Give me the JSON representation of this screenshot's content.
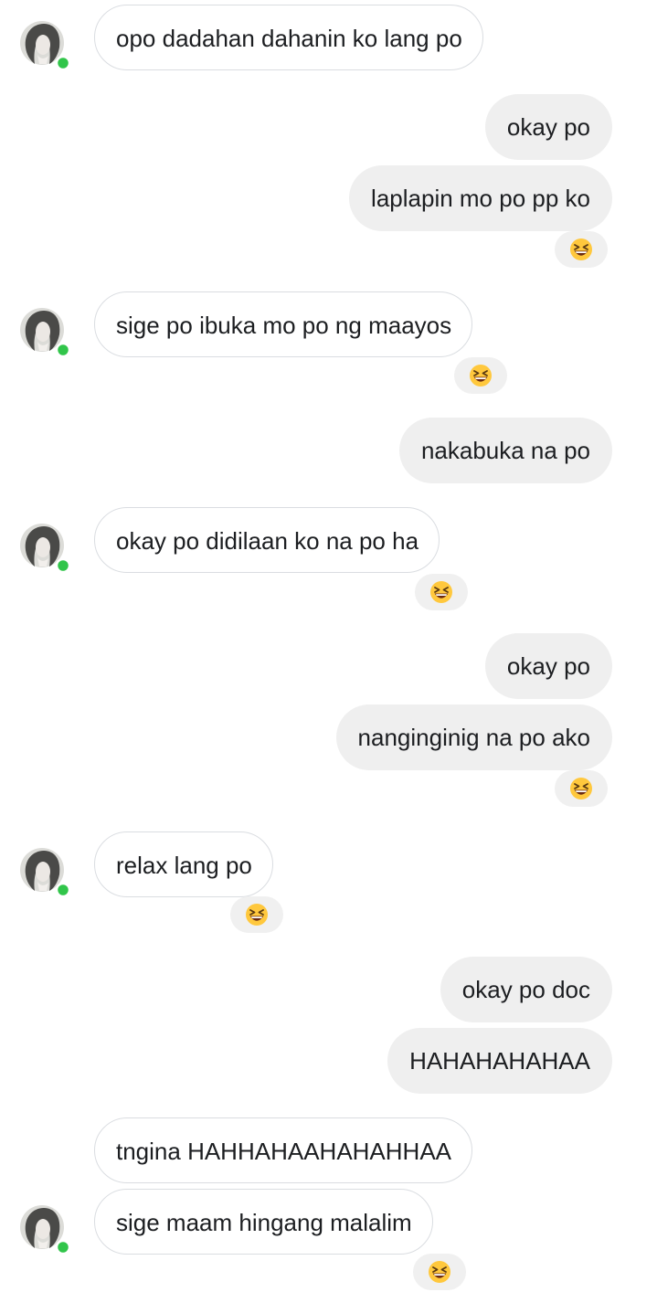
{
  "conversation": {
    "messages": [
      {
        "direction": "incoming",
        "text": "opo dadahan dahanin ko lang po",
        "avatar": true
      },
      {
        "direction": "outgoing",
        "text": "okay po"
      },
      {
        "direction": "outgoing",
        "text": "laplapin mo po pp ko",
        "reaction": "laughing-emoji"
      },
      {
        "direction": "incoming",
        "text": "sige po ibuka mo po ng maayos",
        "avatar": true,
        "reaction": "laughing-emoji"
      },
      {
        "direction": "outgoing",
        "text": "nakabuka na po"
      },
      {
        "direction": "incoming",
        "text": "okay po didilaan ko na po ha",
        "avatar": true,
        "reaction": "laughing-emoji"
      },
      {
        "direction": "outgoing",
        "text": "okay po"
      },
      {
        "direction": "outgoing",
        "text": "nanginginig na po ako",
        "reaction": "laughing-emoji"
      },
      {
        "direction": "incoming",
        "text": "relax lang po",
        "avatar": true,
        "reaction": "laughing-emoji"
      },
      {
        "direction": "outgoing",
        "text": "okay po doc"
      },
      {
        "direction": "outgoing",
        "text": "HAHAHAHAHAA"
      },
      {
        "direction": "incoming",
        "text": "tngina HAHHAHAAHAHAHHAA"
      },
      {
        "direction": "incoming",
        "text": "sige maam hingang malalim",
        "avatar": true,
        "reaction": "laughing-emoji"
      }
    ]
  },
  "colors": {
    "incoming_border": "#dadde1",
    "outgoing_bubble": "#efefef",
    "reaction_bg": "#f0f0f0",
    "online_dot": "#31c54a",
    "emoji_face": "#ffc83d"
  }
}
